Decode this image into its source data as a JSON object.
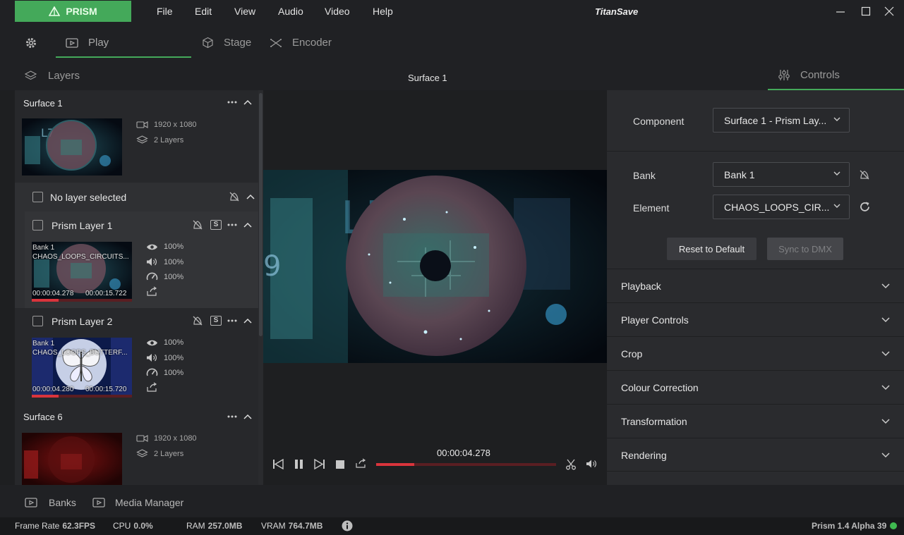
{
  "app": {
    "logo": "PRISM",
    "title": "TitanSave",
    "menu": [
      "File",
      "Edit",
      "View",
      "Audio",
      "Video",
      "Help"
    ]
  },
  "tabs": {
    "play": "Play",
    "stage": "Stage",
    "encoder": "Encoder"
  },
  "headers": {
    "layers": "Layers",
    "center": "Surface 1",
    "controls": "Controls"
  },
  "left": {
    "surface1": {
      "name": "Surface 1",
      "resolution": "1920 x 1080",
      "layers": "2 Layers"
    },
    "no_layer": "No layer selected",
    "layer1": {
      "name": "Prism Layer 1",
      "bank": "Bank 1",
      "clip": "CHAOS_LOOPS_CIRCUITS...",
      "time_current": "00:00:04.278",
      "time_total": "00:00:15.722",
      "opacity": "100%",
      "volume": "100%",
      "speed": "100%",
      "progress": 0.27
    },
    "layer2": {
      "name": "Prism Layer 2",
      "bank": "Bank 1",
      "clip": "CHAOS_LOOPS_BUTTERF...",
      "time_current": "00:00:04.280",
      "time_total": "00:00:15.720",
      "opacity": "100%",
      "volume": "100%",
      "speed": "100%",
      "progress": 0.27
    },
    "surface6": {
      "name": "Surface 6",
      "resolution": "1920 x 1080",
      "layers": "2 Layers"
    },
    "solo_label": "S"
  },
  "player": {
    "timecode": "00:00:04.278",
    "progress": 0.21
  },
  "controls": {
    "component_label": "Component",
    "component_value": "Surface 1 - Prism Lay...",
    "bank_label": "Bank",
    "bank_value": "Bank 1",
    "element_label": "Element",
    "element_value": "CHAOS_LOOPS_CIR...",
    "reset_button": "Reset to Default",
    "sync_button": "Sync to DMX",
    "sections": [
      "Playback",
      "Player Controls",
      "Crop",
      "Colour Correction",
      "Transformation",
      "Rendering"
    ]
  },
  "bottom": {
    "banks": "Banks",
    "media_manager": "Media Manager"
  },
  "status": {
    "frame_rate_label": "Frame Rate",
    "frame_rate": "62.3FPS",
    "cpu_label": "CPU",
    "cpu": "0.0%",
    "ram_label": "RAM",
    "ram": "257.0MB",
    "vram_label": "VRAM",
    "vram": "764.7MB",
    "version": "Prism 1.4 Alpha 39"
  },
  "colors": {
    "accent": "#44a95a",
    "progress": "#d9343c",
    "online": "#3fb950"
  }
}
